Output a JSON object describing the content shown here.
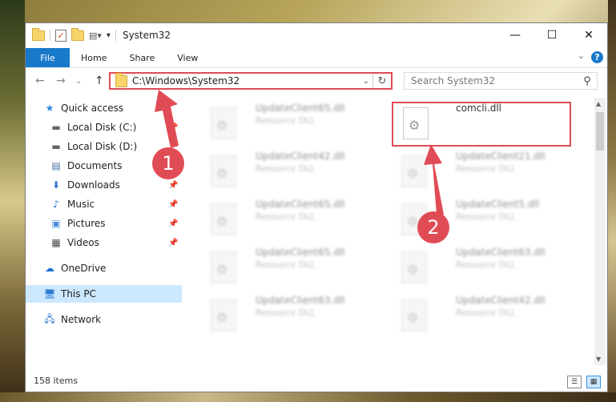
{
  "window": {
    "title": "System32",
    "controls": {
      "minimize": "—",
      "maximize": "☐",
      "close": "✕"
    }
  },
  "ribbon": {
    "file": "File",
    "tabs": [
      "Home",
      "Share",
      "View"
    ],
    "help": "?"
  },
  "address": {
    "path": "C:\\Windows\\System32",
    "dropdown": "⌄",
    "refresh": "↻"
  },
  "search": {
    "placeholder": "Search System32",
    "icon": "search-icon"
  },
  "nav": {
    "back": "←",
    "forward": "→",
    "recent": "⌄",
    "up": "↑",
    "items": [
      {
        "label": "Quick access",
        "icon": "star-icon",
        "pinned": false
      },
      {
        "label": "Local Disk (C:)",
        "icon": "drive-icon",
        "pinned": true
      },
      {
        "label": "Local Disk (D:)",
        "icon": "drive-icon",
        "pinned": false
      },
      {
        "label": "Documents",
        "icon": "documents-icon",
        "pinned": true
      },
      {
        "label": "Downloads",
        "icon": "downloads-icon",
        "pinned": true
      },
      {
        "label": "Music",
        "icon": "music-icon",
        "pinned": true
      },
      {
        "label": "Pictures",
        "icon": "pictures-icon",
        "pinned": true
      },
      {
        "label": "Videos",
        "icon": "videos-icon",
        "pinned": true
      },
      {
        "label": "OneDrive",
        "icon": "cloud-icon",
        "pinned": false
      },
      {
        "label": "This PC",
        "icon": "computer-icon",
        "pinned": false,
        "selected": true
      },
      {
        "label": "Network",
        "icon": "network-icon",
        "pinned": false
      }
    ]
  },
  "files": {
    "highlighted": {
      "name": "comcli.dll",
      "type": ""
    },
    "left_column": [
      {
        "name": "UpdateClient65.dll",
        "type": "Resource DLL"
      },
      {
        "name": "UpdateClient42.dll",
        "type": "Resource DLL"
      },
      {
        "name": "UpdateClient65.dll",
        "type": "Resource DLL"
      },
      {
        "name": "UpdateClient65.dll",
        "type": "Resource DLL"
      },
      {
        "name": "UpdateClient63.dll",
        "type": "Resource DLL"
      }
    ],
    "right_column": [
      {
        "name": "UpdateClient21.dll",
        "type": "Resource DLL"
      },
      {
        "name": "UpdateClient5.dll",
        "type": "Resource DLL"
      },
      {
        "name": "UpdateClient63.dll",
        "type": "Resource DLL"
      },
      {
        "name": "UpdateClient42.dll",
        "type": "Resource DLL"
      }
    ]
  },
  "status": {
    "count": "158 items"
  },
  "annotations": {
    "step1": "1",
    "step2": "2",
    "color": "#e04c55"
  }
}
